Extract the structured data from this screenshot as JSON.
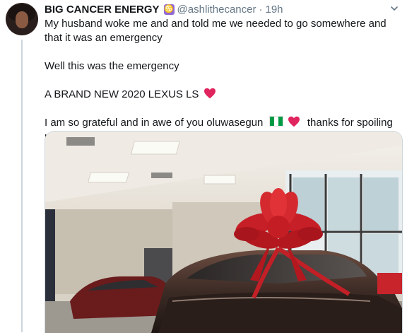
{
  "tweet": {
    "display_name": "BIG CANCER ENERGY",
    "handle": "@ashlithecancer",
    "separator": "·",
    "time": "19h",
    "lines": [
      "My husband woke me and and told me we needed to go somewhere and that it was an emergency",
      "Well this was the emergency",
      "A BRAND NEW 2020 LEXUS LS",
      "I am so grateful and in awe of you oluwasegun",
      "thanks for spoiling me"
    ]
  },
  "icons": {
    "zodiac": "cancer-sign-icon",
    "heart": "red-heart-icon",
    "flag": "nigeria-flag-icon",
    "menu": "chevron-down-icon"
  },
  "colors": {
    "text": "#14171a",
    "secondary": "#657786",
    "heart": "#e0245e",
    "zodiac_badge": "#8f6ad4",
    "bow": "#d0262c"
  }
}
